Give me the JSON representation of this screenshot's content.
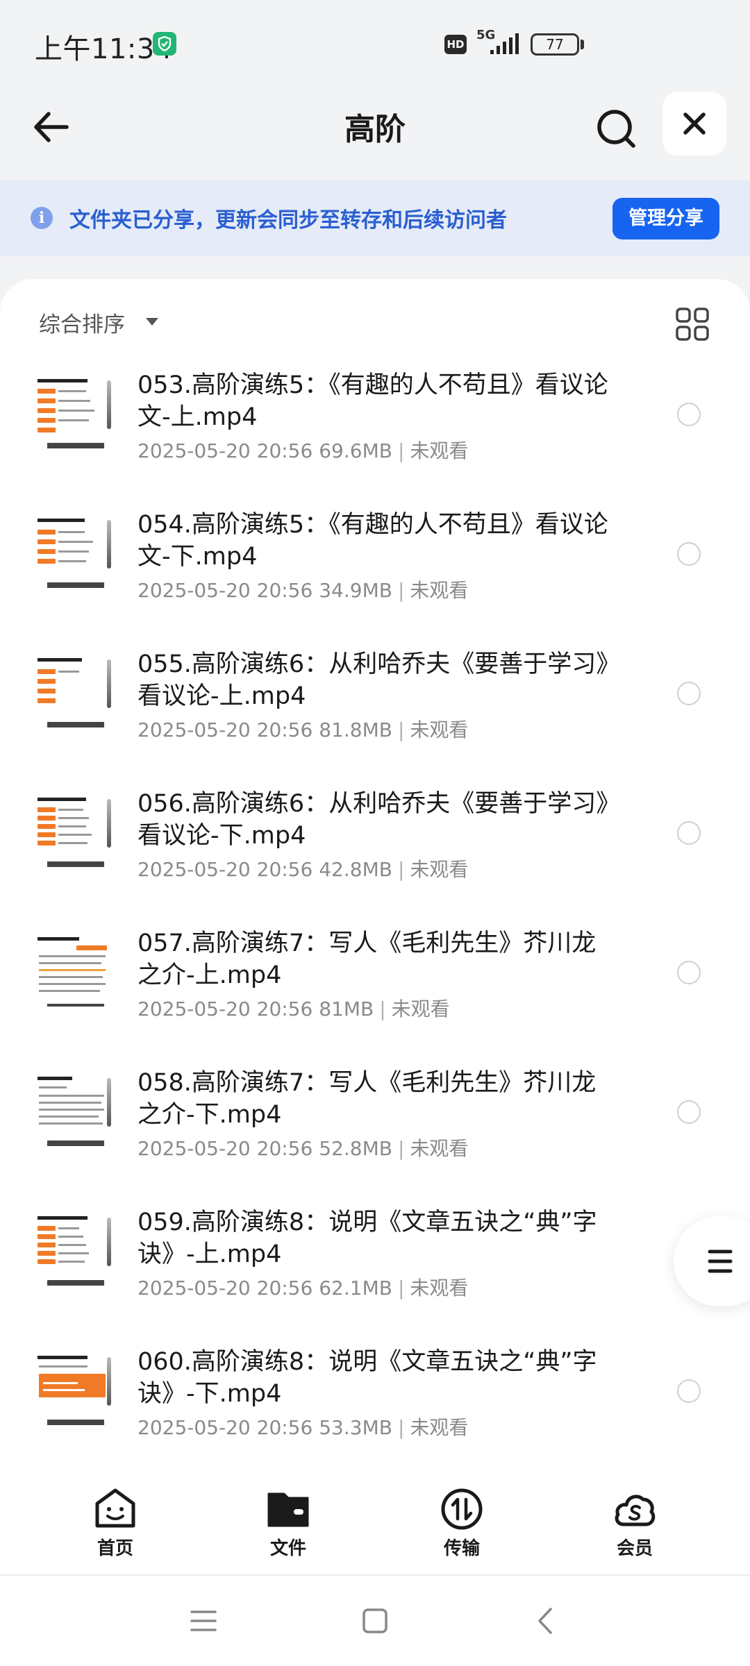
{
  "status_bar": {
    "time": "上午11:34",
    "hd_label": "HD",
    "network_label": "5G",
    "battery_level": "77"
  },
  "header": {
    "title": "高阶",
    "back_icon": "arrow-left-icon",
    "search_icon": "search-icon",
    "close_icon": "close-icon"
  },
  "share_banner": {
    "message": "文件夹已分享，更新会同步至转存和后续访问者",
    "button_label": "管理分享",
    "accent_color": "#1764f0"
  },
  "sort": {
    "label": "综合排序",
    "view_toggle_icon": "grid-view-icon"
  },
  "files": [
    {
      "name": "053.高阶演练5：《有趣的人不苟且》看议论文-上.mp4",
      "date": "2025-05-20 20:56",
      "size": "69.6MB",
      "status": "未观看"
    },
    {
      "name": "054.高阶演练5：《有趣的人不苟且》看议论文-下.mp4",
      "date": "2025-05-20 20:56",
      "size": "34.9MB",
      "status": "未观看"
    },
    {
      "name": "055.高阶演练6：从利哈乔夫《要善于学习》看议论-上.mp4",
      "date": "2025-05-20 20:56",
      "size": "81.8MB",
      "status": "未观看"
    },
    {
      "name": "056.高阶演练6：从利哈乔夫《要善于学习》看议论-下.mp4",
      "date": "2025-05-20 20:56",
      "size": "42.8MB",
      "status": "未观看"
    },
    {
      "name": "057.高阶演练7：写人《毛利先生》芥川龙之介-上.mp4",
      "date": "2025-05-20 20:56",
      "size": "81MB",
      "status": "未观看"
    },
    {
      "name": "058.高阶演练7：写人《毛利先生》芥川龙之介-下.mp4",
      "date": "2025-05-20 20:56",
      "size": "52.8MB",
      "status": "未观看"
    },
    {
      "name": "059.高阶演练8：说明《文章五诀之“典”字诀》-上.mp4",
      "date": "2025-05-20 20:56",
      "size": "62.1MB",
      "status": "未观看"
    },
    {
      "name": "060.高阶演练8：说明《文章五诀之“典”字诀》-下.mp4",
      "date": "2025-05-20 20:56",
      "size": "53.3MB",
      "status": "未观看"
    }
  ],
  "bottom_nav": [
    {
      "label": "首页",
      "icon": "home-smile-icon"
    },
    {
      "label": "文件",
      "icon": "folder-icon"
    },
    {
      "label": "传输",
      "icon": "transfer-icon"
    },
    {
      "label": "会员",
      "icon": "vip-cloud-icon"
    }
  ],
  "system_nav": {
    "menu_icon": "menu-icon",
    "home_icon": "square-home-icon",
    "back_icon": "back-chevron-icon"
  }
}
